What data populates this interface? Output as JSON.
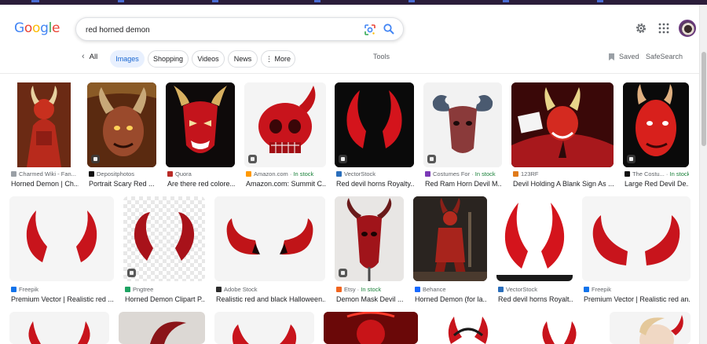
{
  "search": {
    "query": "red horned demon",
    "logo": "Google"
  },
  "nav": {
    "back_label": "All",
    "chips": [
      "Images",
      "Shopping",
      "Videos",
      "News",
      "More"
    ],
    "tools": "Tools",
    "saved": "Saved",
    "safesearch": "SafeSearch"
  },
  "results": [
    {
      "source": "Charmed Wiki - Fan...",
      "title": "Horned Demon | Ch...",
      "stock": ""
    },
    {
      "source": "Depositphotos",
      "title": "Portrait Scary Red ...",
      "stock": ""
    },
    {
      "source": "Quora",
      "title": "Are there red colore...",
      "stock": ""
    },
    {
      "source": "Amazon.com · ",
      "title": "Amazon.com: Summit C...",
      "stock": "In stock"
    },
    {
      "source": "VectorStock",
      "title": "Red devil horns Royalty...",
      "stock": ""
    },
    {
      "source": "Costumes For · ",
      "title": "Red Ram Horn Devil M...",
      "stock": "In stock"
    },
    {
      "source": "123RF",
      "title": "Devil Holding A Blank Sign As ...",
      "stock": ""
    },
    {
      "source": "The Costu... · ",
      "title": "Large Red Devil De...",
      "stock": "In stock"
    },
    {
      "source": "Freepik",
      "title": "Premium Vector | Realistic red ...",
      "stock": ""
    },
    {
      "source": "Pngtree",
      "title": "Horned Demon Clipart P...",
      "stock": ""
    },
    {
      "source": "Adobe Stock",
      "title": "Realistic red and black Halloween...",
      "stock": ""
    },
    {
      "source": "Etsy · ",
      "title": "Demon Mask Devil ...",
      "stock": "In stock"
    },
    {
      "source": "Behance",
      "title": "Horned Demon (for la...",
      "stock": ""
    },
    {
      "source": "VectorStock",
      "title": "Red devil horns Royalt...",
      "stock": ""
    },
    {
      "source": "Freepik",
      "title": "Premium Vector | Realistic red an...",
      "stock": ""
    }
  ],
  "colors": {
    "accent": "#1a73e8",
    "stock": "#188038",
    "demon_red": "#c8141c"
  }
}
